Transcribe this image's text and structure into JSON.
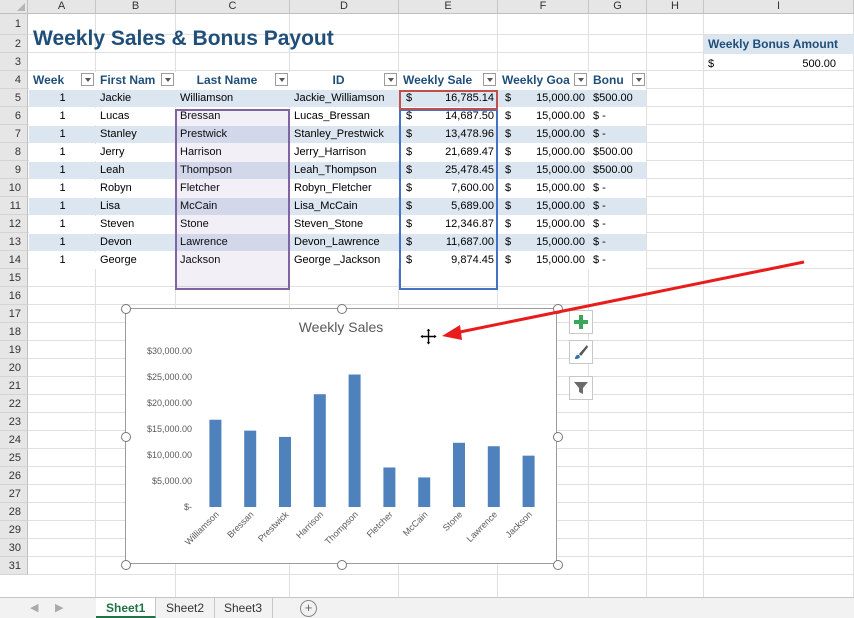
{
  "columns": [
    "A",
    "B",
    "C",
    "D",
    "E",
    "F",
    "G",
    "H",
    "I"
  ],
  "rows": [
    "1",
    "2",
    "3",
    "4",
    "5",
    "6",
    "7",
    "8",
    "9",
    "10",
    "11",
    "12",
    "13",
    "14",
    "15",
    "16",
    "17",
    "18",
    "19",
    "20",
    "21",
    "22",
    "23",
    "24",
    "25",
    "26",
    "27",
    "28",
    "29",
    "30",
    "31"
  ],
  "sheet": {
    "title": "Weekly Sales & Bonus Payout",
    "bonus_label": "Weekly Bonus Amount",
    "bonus_currency": "$",
    "bonus_amount": "500.00",
    "headers": [
      "Week",
      "First Nam",
      "Last Name",
      "ID",
      "Weekly Sale",
      "Weekly Goa",
      "Bonu"
    ],
    "table_rows": [
      {
        "week": "1",
        "first": "Jackie",
        "last": "Williamson",
        "id": "Jackie_Williamson",
        "sales": "16,785.14",
        "goal": "15,000.00",
        "bonus": "$500.00"
      },
      {
        "week": "1",
        "first": "Lucas",
        "last": "Bressan",
        "id": "Lucas_Bressan",
        "sales": "14,687.50",
        "goal": "15,000.00",
        "bonus": "$      -"
      },
      {
        "week": "1",
        "first": "Stanley",
        "last": "Prestwick",
        "id": "Stanley_Prestwick",
        "sales": "13,478.96",
        "goal": "15,000.00",
        "bonus": "$      -"
      },
      {
        "week": "1",
        "first": "Jerry",
        "last": "Harrison",
        "id": "Jerry_Harrison",
        "sales": "21,689.47",
        "goal": "15,000.00",
        "bonus": "$500.00"
      },
      {
        "week": "1",
        "first": "Leah",
        "last": "Thompson",
        "id": "Leah_Thompson",
        "sales": "25,478.45",
        "goal": "15,000.00",
        "bonus": "$500.00"
      },
      {
        "week": "1",
        "first": "Robyn",
        "last": "Fletcher",
        "id": "Robyn_Fletcher",
        "sales": "7,600.00",
        "goal": "15,000.00",
        "bonus": "$      -"
      },
      {
        "week": "1",
        "first": "Lisa",
        "last": "McCain",
        "id": "Lisa_McCain",
        "sales": "5,689.00",
        "goal": "15,000.00",
        "bonus": "$      -"
      },
      {
        "week": "1",
        "first": "Steven",
        "last": "Stone",
        "id": "Steven_Stone",
        "sales": "12,346.87",
        "goal": "15,000.00",
        "bonus": "$      -"
      },
      {
        "week": "1",
        "first": "Devon",
        "last": "Lawrence",
        "id": "Devon_Lawrence",
        "sales": "11,687.00",
        "goal": "15,000.00",
        "bonus": "$      -"
      },
      {
        "week": "1",
        "first": "George",
        "last": "Jackson",
        "id": "George _Jackson",
        "sales": "9,874.45",
        "goal": "15,000.00",
        "bonus": "$      -"
      }
    ]
  },
  "chart_data": {
    "type": "bar",
    "title": "Weekly Sales",
    "categories": [
      "Williamson",
      "Bressan",
      "Prestwick",
      "Harrison",
      "Thompson",
      "Fletcher",
      "McCain",
      "Stone",
      "Lawrence",
      "Jackson"
    ],
    "values": [
      16785.14,
      14687.5,
      13478.96,
      21689.47,
      25478.45,
      7600.0,
      5689.0,
      12346.87,
      11687.0,
      9874.45
    ],
    "ylim": [
      0,
      30000
    ],
    "yticks": [
      "$-",
      "$5,000.00",
      "$10,000.00",
      "$15,000.00",
      "$20,000.00",
      "$25,000.00",
      "$30,000.00"
    ],
    "bar_color": "#4f81bd",
    "grid": false,
    "legend": "none"
  },
  "side_buttons": [
    "chart-elements-icon",
    "chart-styles-icon",
    "chart-filters-icon"
  ],
  "tabs": [
    "Sheet1",
    "Sheet2",
    "Sheet3"
  ],
  "active_tab": "Sheet1",
  "colors": {
    "accent": "#217346",
    "title": "#1f4e79",
    "band": "#dce6f1",
    "arrow": "#e81c1c"
  }
}
